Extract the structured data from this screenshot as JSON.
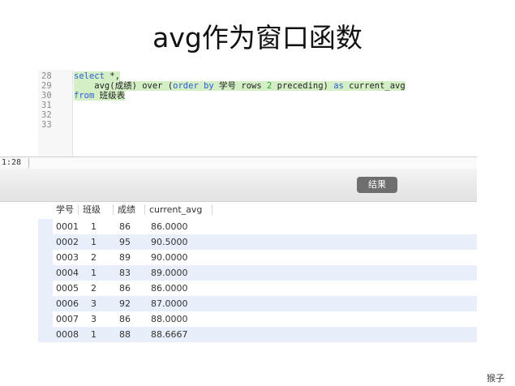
{
  "title": "avg作为窗口函数",
  "editor": {
    "line_numbers": [
      "28",
      "29",
      "30",
      "31",
      "32",
      "33"
    ],
    "code": {
      "l28_kw": "select",
      "l28_rest": " *,",
      "l29_a": "    avg(成绩) over (",
      "l29_kw1": "order by",
      "l29_b": " 学号 rows ",
      "l29_num": "2",
      "l29_c": " preceding) ",
      "l29_kw2": "as",
      "l29_d": " current_avg",
      "l30_kw": "from",
      "l30_rest": " 班级表"
    }
  },
  "status": {
    "cursor": "1:28"
  },
  "results_tab": {
    "label": "结果"
  },
  "table": {
    "headers": [
      "学号",
      "班级",
      "成绩",
      "current_avg"
    ],
    "rows": [
      [
        "0001",
        "1",
        "86",
        "86.0000"
      ],
      [
        "0002",
        "1",
        "95",
        "90.5000"
      ],
      [
        "0003",
        "2",
        "89",
        "90.0000"
      ],
      [
        "0004",
        "1",
        "83",
        "89.0000"
      ],
      [
        "0005",
        "2",
        "86",
        "86.0000"
      ],
      [
        "0006",
        "3",
        "92",
        "87.0000"
      ],
      [
        "0007",
        "3",
        "86",
        "88.0000"
      ],
      [
        "0008",
        "1",
        "88",
        "88.6667"
      ]
    ]
  },
  "footer": {
    "author": "猴子"
  }
}
